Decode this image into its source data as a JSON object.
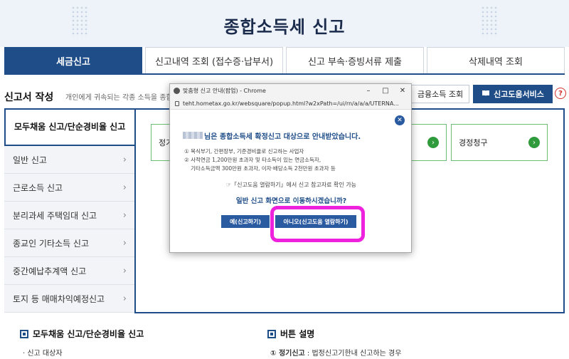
{
  "header": {
    "title": "종합소득세 신고"
  },
  "tabs": [
    {
      "label": "세금신고"
    },
    {
      "label": "신고내역 조회 (접수증·납부서)"
    },
    {
      "label": "신고 부속·증빙서류 제출"
    },
    {
      "label": "삭제내역 조회"
    }
  ],
  "section": {
    "title": "신고서 작성",
    "desc": "개인에게 귀속되는 각종 소득을 종합하여",
    "fin_button": "금융소득 조회",
    "help_button": "신고도움서비스"
  },
  "sidebar": {
    "active": "모두채움 신고/단순경비율 신고",
    "items": [
      {
        "label": "일반 신고"
      },
      {
        "label": "근로소득 신고"
      },
      {
        "label": "분리과세 주택임대 신고"
      },
      {
        "label": "종교인 기타소득 신고"
      },
      {
        "label": "중간예납추계액 신고"
      },
      {
        "label": "토지 등 매매차익예정신고"
      }
    ]
  },
  "cards": {
    "left": "정기",
    "right": "경정청구"
  },
  "popup": {
    "window_title": "맞춤형 신고 안내(팝업) - Chrome",
    "url": "teht.hometax.go.kr/websquare/popup.html?w2xPath=/ui/rn/a/a/a/UTERNA...",
    "headline": "님은 종합소득세 확정신고 대상으로 안내받았습니다.",
    "line1": "① 복식부기, 간편장부, 기준경비율로 신고하는 사업자",
    "line2": "② 사적연금 1,200만원 초과자 및 타소득이 있는 연금소득자,",
    "line3": "기타소득금액 300만원 초과자, 이자·배당소득 2천만원 초과자 등",
    "ref": "☞「신고도움 열람하기」에서 신고 참고자료 확인 가능",
    "question": "일반 신고 화면으로 이동하시겠습니까?",
    "yes_button": "예(신고하기)",
    "no_button": "아니오(신고도움 열람하기)"
  },
  "bottom": {
    "left_heading": "모두채움 신고/단순경비율 신고",
    "left_sub": "· 신고 대상자",
    "right_heading": "버튼 설명",
    "right_sub_label": "① 정기신고",
    "right_sub_text": " : 법정신고기한내 신고하는 경우"
  },
  "colors": {
    "primary": "#1f4d88",
    "highlight": "#ee22dd",
    "go_green": "#2f9b3c"
  }
}
